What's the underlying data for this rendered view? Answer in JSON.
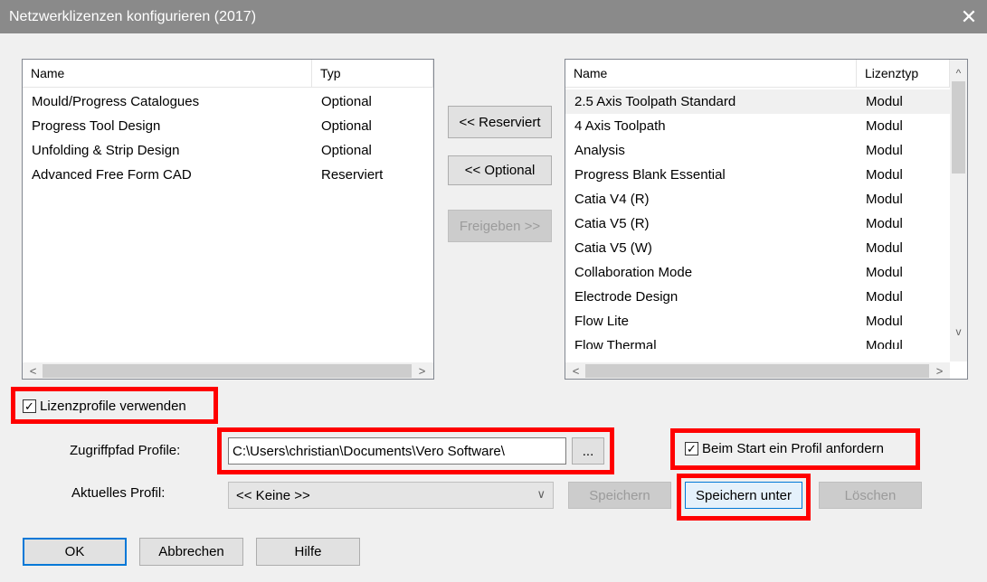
{
  "window": {
    "title": "Netzwerklizenzen konfigurieren (2017)",
    "close_glyph": "✕"
  },
  "left_list": {
    "columns": [
      "Name",
      "Typ"
    ],
    "rows": [
      {
        "name": "Mould/Progress Catalogues",
        "type": "Optional"
      },
      {
        "name": "Progress Tool Design",
        "type": "Optional"
      },
      {
        "name": "Unfolding & Strip Design",
        "type": "Optional"
      },
      {
        "name": "Advanced Free Form CAD",
        "type": "Reserviert"
      }
    ]
  },
  "middle_buttons": {
    "reserve": "<< Reserviert",
    "optional": "<< Optional",
    "release": "Freigeben >>"
  },
  "right_list": {
    "columns": [
      "Name",
      "Lizenztyp"
    ],
    "rows": [
      {
        "name": "2.5 Axis Toolpath Standard",
        "type": "Modul"
      },
      {
        "name": "4 Axis Toolpath",
        "type": "Modul"
      },
      {
        "name": "Analysis",
        "type": "Modul"
      },
      {
        "name": "Progress Blank Essential",
        "type": "Modul"
      },
      {
        "name": "Catia V4 (R)",
        "type": "Modul"
      },
      {
        "name": "Catia V5 (R)",
        "type": "Modul"
      },
      {
        "name": "Catia V5 (W)",
        "type": "Modul"
      },
      {
        "name": "Collaboration Mode",
        "type": "Modul"
      },
      {
        "name": "Electrode Design",
        "type": "Modul"
      },
      {
        "name": "Flow Lite",
        "type": "Modul"
      },
      {
        "name": "Flow Thermal",
        "type": "Modul"
      }
    ]
  },
  "use_profiles": {
    "label": "Lizenzprofile verwenden",
    "checked": true
  },
  "access_path": {
    "label": "Zugriffpfad Profile:",
    "value": "C:\\Users\\christian\\Documents\\Vero Software\\",
    "browse": "..."
  },
  "request_profile": {
    "label": "Beim Start ein Profil anfordern",
    "checked": true
  },
  "current_profile": {
    "label": "Aktuelles Profil:",
    "value": "<< Keine >>"
  },
  "profile_buttons": {
    "save": "Speichern",
    "save_as": "Speichern unter",
    "delete": "Löschen"
  },
  "footer_buttons": {
    "ok": "OK",
    "cancel": "Abbrechen",
    "help": "Hilfe"
  },
  "icons": {
    "check": "✓",
    "left": "<",
    "right": ">",
    "up": "^",
    "down": "v",
    "combo_down": "∨"
  },
  "colors": {
    "titlebar": "#8a8a8a",
    "highlight": "#ff0000",
    "focus": "#0078d7"
  }
}
